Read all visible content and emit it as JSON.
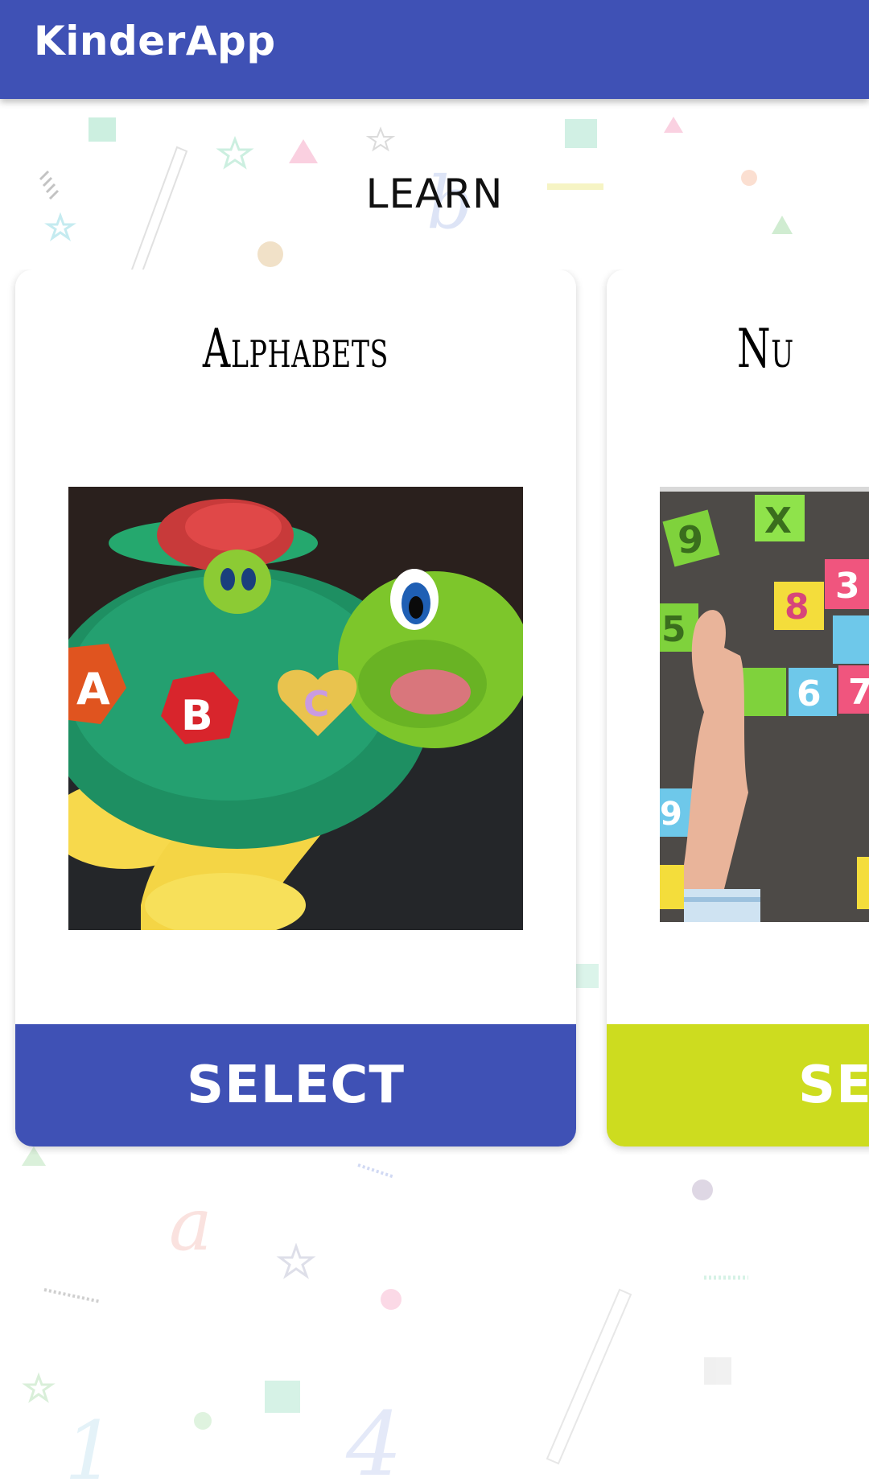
{
  "app": {
    "title": "KinderApp"
  },
  "colors": {
    "primary": "#3F51B5",
    "accent_lime": "#CDDC1F"
  },
  "section": {
    "title": "LEARN"
  },
  "cards": [
    {
      "title": "Alphabets",
      "image": "turtle-toy-with-abc-letters",
      "select_label": "SELECT",
      "button_color": "#3F51B5"
    },
    {
      "title": "Nu",
      "image": "number-tiles-with-child-hand",
      "select_label": "SEL",
      "button_color": "#CDDC1F"
    }
  ]
}
